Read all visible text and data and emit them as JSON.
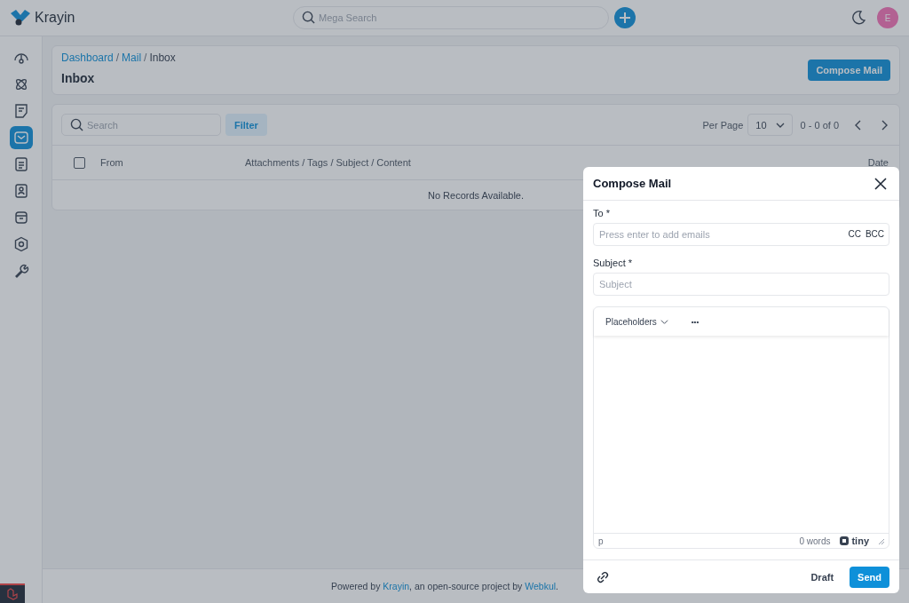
{
  "app": {
    "name": "Krayin"
  },
  "header": {
    "search_placeholder": "Mega Search",
    "avatar_initial": "E"
  },
  "sidebar": {
    "items": [
      {
        "selected": false
      },
      {
        "selected": false
      },
      {
        "selected": false
      },
      {
        "selected": true
      },
      {
        "selected": false
      },
      {
        "selected": false
      },
      {
        "selected": false
      },
      {
        "selected": false
      },
      {
        "selected": false
      }
    ]
  },
  "breadcrumb": [
    {
      "label": "Dashboard",
      "link": true
    },
    {
      "separator": "/",
      "label": "Mail",
      "link": true
    },
    {
      "separator": "/",
      "label": "Inbox",
      "link": false
    }
  ],
  "page_title": "Inbox",
  "compose_button": "Compose Mail",
  "toolbar": {
    "search_placeholder": "Search",
    "filter_button": "Filter",
    "per_page_label": "Per Page",
    "per_page_value": "10",
    "range": "0 - 0 of 0"
  },
  "table": {
    "select_all_checked": false,
    "columns": [
      "From",
      "Attachments / Tags / Subject / Content",
      "Date"
    ],
    "empty_message": "No Records Available."
  },
  "footer": {
    "before": "Powered by ",
    "link1": "Krayin",
    "middle": ", an open-source project by ",
    "link2": "Webkul",
    "after": "."
  },
  "dialog": {
    "title": "Compose Mail",
    "to_label": "To *",
    "to_placeholder": "Press enter to add emails",
    "cc": "CC",
    "bcc": "BCC",
    "subject_label": "Subject *",
    "subject_placeholder": "Subject",
    "editor": {
      "menu": "Placeholders",
      "more": "•••",
      "path": "p",
      "word_count": "0 words",
      "brand": "tiny"
    },
    "draft_button": "Draft",
    "send_button": "Send"
  }
}
